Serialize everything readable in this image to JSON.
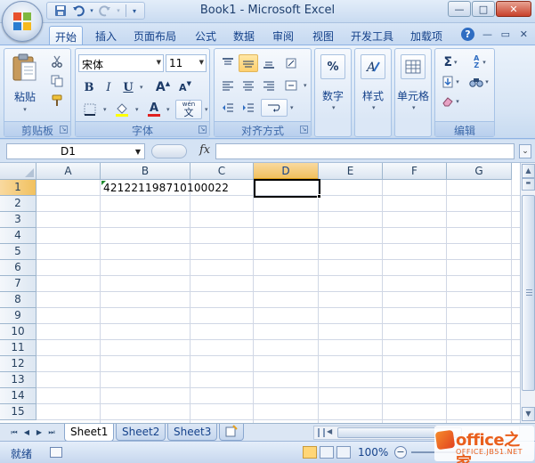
{
  "window": {
    "title": "Book1 - Microsoft Excel",
    "controls": {
      "minimize": "—",
      "maximize": "□",
      "close": "✕"
    }
  },
  "quick_access": {
    "save": "save-icon",
    "undo": "undo-icon",
    "redo": "redo-icon",
    "customize": "▾"
  },
  "ribbon_tabs": [
    "开始",
    "插入",
    "页面布局",
    "公式",
    "数据",
    "审阅",
    "视图",
    "开发工具",
    "加载项"
  ],
  "active_tab": "开始",
  "ribbon": {
    "clipboard": {
      "paste_label": "粘贴",
      "group_label": "剪贴板"
    },
    "font": {
      "font_name": "宋体",
      "font_size": "11",
      "bold": "B",
      "italic": "I",
      "underline": "U",
      "grow": "A",
      "shrink": "A",
      "phonetic": "wén",
      "phonetic_char": "文",
      "font_color_letter": "A",
      "group_label": "字体"
    },
    "alignment": {
      "group_label": "对齐方式"
    },
    "number": {
      "symbol": "%",
      "label": "数字"
    },
    "styles": {
      "label": "样式"
    },
    "cells": {
      "label": "单元格"
    },
    "editing": {
      "sum_symbol": "Σ",
      "sort_symbol": "A Z",
      "group_label": "编辑"
    }
  },
  "formula_bar": {
    "name_box": "D1",
    "fx": "fx",
    "formula": ""
  },
  "columns": [
    "A",
    "B",
    "C",
    "D",
    "E",
    "F",
    "G"
  ],
  "active_column": "D",
  "rows": [
    "1",
    "2",
    "3",
    "4",
    "5",
    "6",
    "7",
    "8",
    "9",
    "10",
    "11",
    "12",
    "13",
    "14",
    "15"
  ],
  "active_row": "1",
  "cells": {
    "B1": "421221198710100022"
  },
  "selected_cell": "D1",
  "sheets": [
    "Sheet1",
    "Sheet2",
    "Sheet3"
  ],
  "active_sheet": "Sheet1",
  "status": {
    "ready": "就绪",
    "zoom": "100%"
  },
  "watermark": {
    "main": "office之家",
    "sub": "OFFICE.JB51.NET"
  },
  "colors": {
    "accent": "#15428b",
    "selected_header": "#f1c15f",
    "ribbon_bg": "#dbe7f6",
    "error_indicator": "#1f8a2e"
  }
}
